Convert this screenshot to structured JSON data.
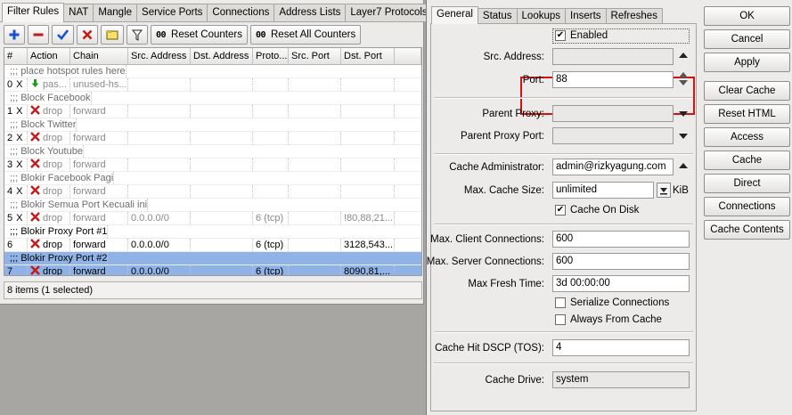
{
  "firewall": {
    "tabs": [
      "Filter Rules",
      "NAT",
      "Mangle",
      "Service Ports",
      "Connections",
      "Address Lists",
      "Layer7 Protocols"
    ],
    "toolbar": {
      "reset_counters": "Reset Counters",
      "reset_all_counters": "Reset All Counters",
      "counter_glyph": "00"
    },
    "columns": [
      "#",
      "Action",
      "Chain",
      "Src. Address",
      "Dst. Address",
      "Proto...",
      "Src. Port",
      "Dst. Port"
    ],
    "rows": [
      {
        "type": "comment",
        "text": ";;; place hotspot rules here"
      },
      {
        "type": "rule",
        "num": "0",
        "flag": "X",
        "action": "pas...",
        "chain": "unused-hs...",
        "src": "",
        "dst": "",
        "proto": "",
        "sport": "",
        "dport": "",
        "icon": "accept"
      },
      {
        "type": "comment",
        "text": ";;; Block Facebook"
      },
      {
        "type": "rule",
        "num": "1",
        "flag": "X",
        "action": "drop",
        "chain": "forward",
        "src": "",
        "dst": "",
        "proto": "",
        "sport": "",
        "dport": "",
        "icon": "drop"
      },
      {
        "type": "comment",
        "text": ";;; Block Twitter"
      },
      {
        "type": "rule",
        "num": "2",
        "flag": "X",
        "action": "drop",
        "chain": "forward",
        "src": "",
        "dst": "",
        "proto": "",
        "sport": "",
        "dport": "",
        "icon": "drop"
      },
      {
        "type": "comment",
        "text": ";;; Block Youtube"
      },
      {
        "type": "rule",
        "num": "3",
        "flag": "X",
        "action": "drop",
        "chain": "forward",
        "src": "",
        "dst": "",
        "proto": "",
        "sport": "",
        "dport": "",
        "icon": "drop"
      },
      {
        "type": "comment",
        "text": ";;; Blokir Facebook Pagi"
      },
      {
        "type": "rule",
        "num": "4",
        "flag": "X",
        "action": "drop",
        "chain": "forward",
        "src": "",
        "dst": "",
        "proto": "",
        "sport": "",
        "dport": "",
        "icon": "drop"
      },
      {
        "type": "comment",
        "text": ";;; Blokir Semua Port Kecuali ini"
      },
      {
        "type": "rule",
        "num": "5",
        "flag": "X",
        "action": "drop",
        "chain": "forward",
        "src": "0.0.0.0/0",
        "dst": "",
        "proto": "6 (tcp)",
        "sport": "",
        "dport": "!80,88,21...",
        "icon": "drop"
      },
      {
        "type": "comment",
        "text": ";;; Blokir Proxy Port #1",
        "enabled": true
      },
      {
        "type": "rule",
        "num": "6",
        "flag": "",
        "action": "drop",
        "chain": "forward",
        "src": "0.0.0.0/0",
        "dst": "",
        "proto": "6 (tcp)",
        "sport": "",
        "dport": "3128,543...",
        "icon": "drop",
        "enabled": true
      },
      {
        "type": "comment",
        "text": ";;; Blokir Proxy Port #2",
        "enabled": true,
        "selected": true
      },
      {
        "type": "rule",
        "num": "7",
        "flag": "",
        "action": "drop",
        "chain": "forward",
        "src": "0.0.0.0/0",
        "dst": "",
        "proto": "6 (tcp)",
        "sport": "",
        "dport": "8090,81,...",
        "icon": "drop",
        "enabled": true,
        "selected": true
      }
    ],
    "status": "8 items (1 selected)"
  },
  "proxy": {
    "tabs": [
      "General",
      "Status",
      "Lookups",
      "Inserts",
      "Refreshes"
    ],
    "enabled_label": "Enabled",
    "fields": {
      "src_address_label": "Src. Address:",
      "src_address": "",
      "port_label": "Port:",
      "port": "88",
      "parent_proxy_label": "Parent Proxy:",
      "parent_proxy": "",
      "parent_proxy_port_label": "Parent Proxy Port:",
      "parent_proxy_port": "",
      "cache_admin_label": "Cache Administrator:",
      "cache_admin": "admin@rizkyagung.com",
      "max_cache_size_label": "Max. Cache Size:",
      "max_cache_size": "unlimited",
      "kib": "KiB",
      "cache_on_disk_label": "Cache On Disk",
      "max_client_conn_label": "Max. Client Connections:",
      "max_client_conn": "600",
      "max_server_conn_label": "Max. Server Connections:",
      "max_server_conn": "600",
      "max_fresh_time_label": "Max Fresh Time:",
      "max_fresh_time": "3d 00:00:00",
      "serialize_label": "Serialize Connections",
      "always_cache_label": "Always From Cache",
      "cache_hit_dscp_label": "Cache Hit DSCP (TOS):",
      "cache_hit_dscp": "4",
      "cache_drive_label": "Cache Drive:",
      "cache_drive": "system"
    },
    "buttons": [
      "OK",
      "Cancel",
      "Apply",
      "Clear Cache",
      "Reset HTML",
      "Access",
      "Cache",
      "Direct",
      "Connections",
      "Cache Contents"
    ]
  },
  "colors": {
    "highlight": "#d11414",
    "selection": "#8fb2e7",
    "add": "#1c4fd4",
    "remove": "#c21b1b",
    "enable": "#1c4fd4",
    "disable": "#c21b1b",
    "accept": "#1f9b1f"
  }
}
